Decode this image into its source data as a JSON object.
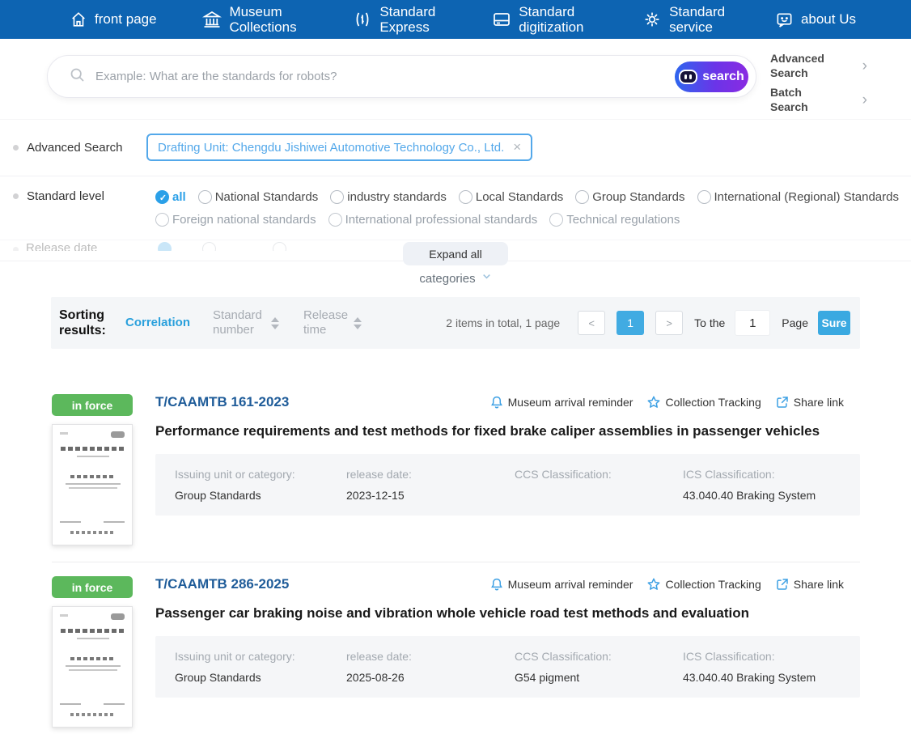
{
  "nav": {
    "items": [
      {
        "icon": "home-icon",
        "label": "front page"
      },
      {
        "icon": "museum-icon",
        "label": "Museum Collections"
      },
      {
        "icon": "express-icon",
        "label": "Standard Express"
      },
      {
        "icon": "digitization-icon",
        "label": "Standard digitization"
      },
      {
        "icon": "service-gear-icon",
        "label": "Standard service"
      },
      {
        "icon": "about-chat-icon",
        "label": "about Us"
      }
    ]
  },
  "search": {
    "placeholder": "Example: What are the standards for robots?",
    "button_label": "search",
    "advanced_search_label": "Advanced Search",
    "batch_search_label": "Batch Search"
  },
  "filters": {
    "advanced_search": {
      "label": "Advanced Search",
      "tag": "Drafting Unit: Chengdu Jishiwei Automotive Technology Co., Ltd.",
      "tag_close": "×"
    },
    "standard_level": {
      "label": "Standard level",
      "selected": "all",
      "options_row1": [
        "all",
        "National Standards",
        "industry standards",
        "Local Standards",
        "Group Standards",
        "International (Regional) Standards"
      ],
      "options_row2": [
        "Foreign national standards",
        "International professional standards",
        "Technical regulations"
      ]
    },
    "release_date_label": "Release date",
    "expand_all_label": "Expand all",
    "categories_label": "categories"
  },
  "sorting": {
    "label": "Sorting results:",
    "options": [
      "Correlation",
      "Standard number",
      "Release time"
    ],
    "active": "Correlation",
    "summary": "2 items in total, 1 page",
    "prev_label": "<",
    "current_page": "1",
    "next_label": ">",
    "goto_prefix": "To the",
    "goto_value": "1",
    "goto_suffix": "Page",
    "confirm_label": "Sure"
  },
  "results": [
    {
      "status": "in force",
      "code": "T/CAAMTB 161-2023",
      "title": "Performance requirements and test methods for fixed brake caliper assemblies in passenger vehicles",
      "actions": [
        "Museum arrival reminder",
        "Collection Tracking",
        "Share link"
      ],
      "fields": [
        {
          "label": "Issuing unit or category:",
          "value": "Group Standards"
        },
        {
          "label": "release date:",
          "value": "2023-12-15"
        },
        {
          "label": "CCS Classification:",
          "value": ""
        },
        {
          "label": "ICS Classification:",
          "value": "43.040.40 Braking System"
        }
      ]
    },
    {
      "status": "in force",
      "code": "T/CAAMTB 286-2025",
      "title": "Passenger car braking noise and vibration whole vehicle road test methods and evaluation",
      "actions": [
        "Museum arrival reminder",
        "Collection Tracking",
        "Share link"
      ],
      "fields": [
        {
          "label": "Issuing unit or category:",
          "value": "Group Standards"
        },
        {
          "label": "release date:",
          "value": "2025-08-26"
        },
        {
          "label": "CCS Classification:",
          "value": "G54 pigment"
        },
        {
          "label": "ICS Classification:",
          "value": "43.040.40 Braking System"
        }
      ]
    }
  ],
  "colors": {
    "nav_blue": "#0d64b2",
    "accent_blue": "#2ba0e8",
    "tag_blue": "#53a8ea",
    "code_blue": "#1f5c99",
    "active_sort_blue": "#2aa0dc",
    "pager_blue": "#41abe2",
    "badge_green": "#5cb85c",
    "panel_gray": "#f5f6f8",
    "button_gradient_start": "#2e66ee",
    "button_gradient_end": "#8a2be2"
  }
}
